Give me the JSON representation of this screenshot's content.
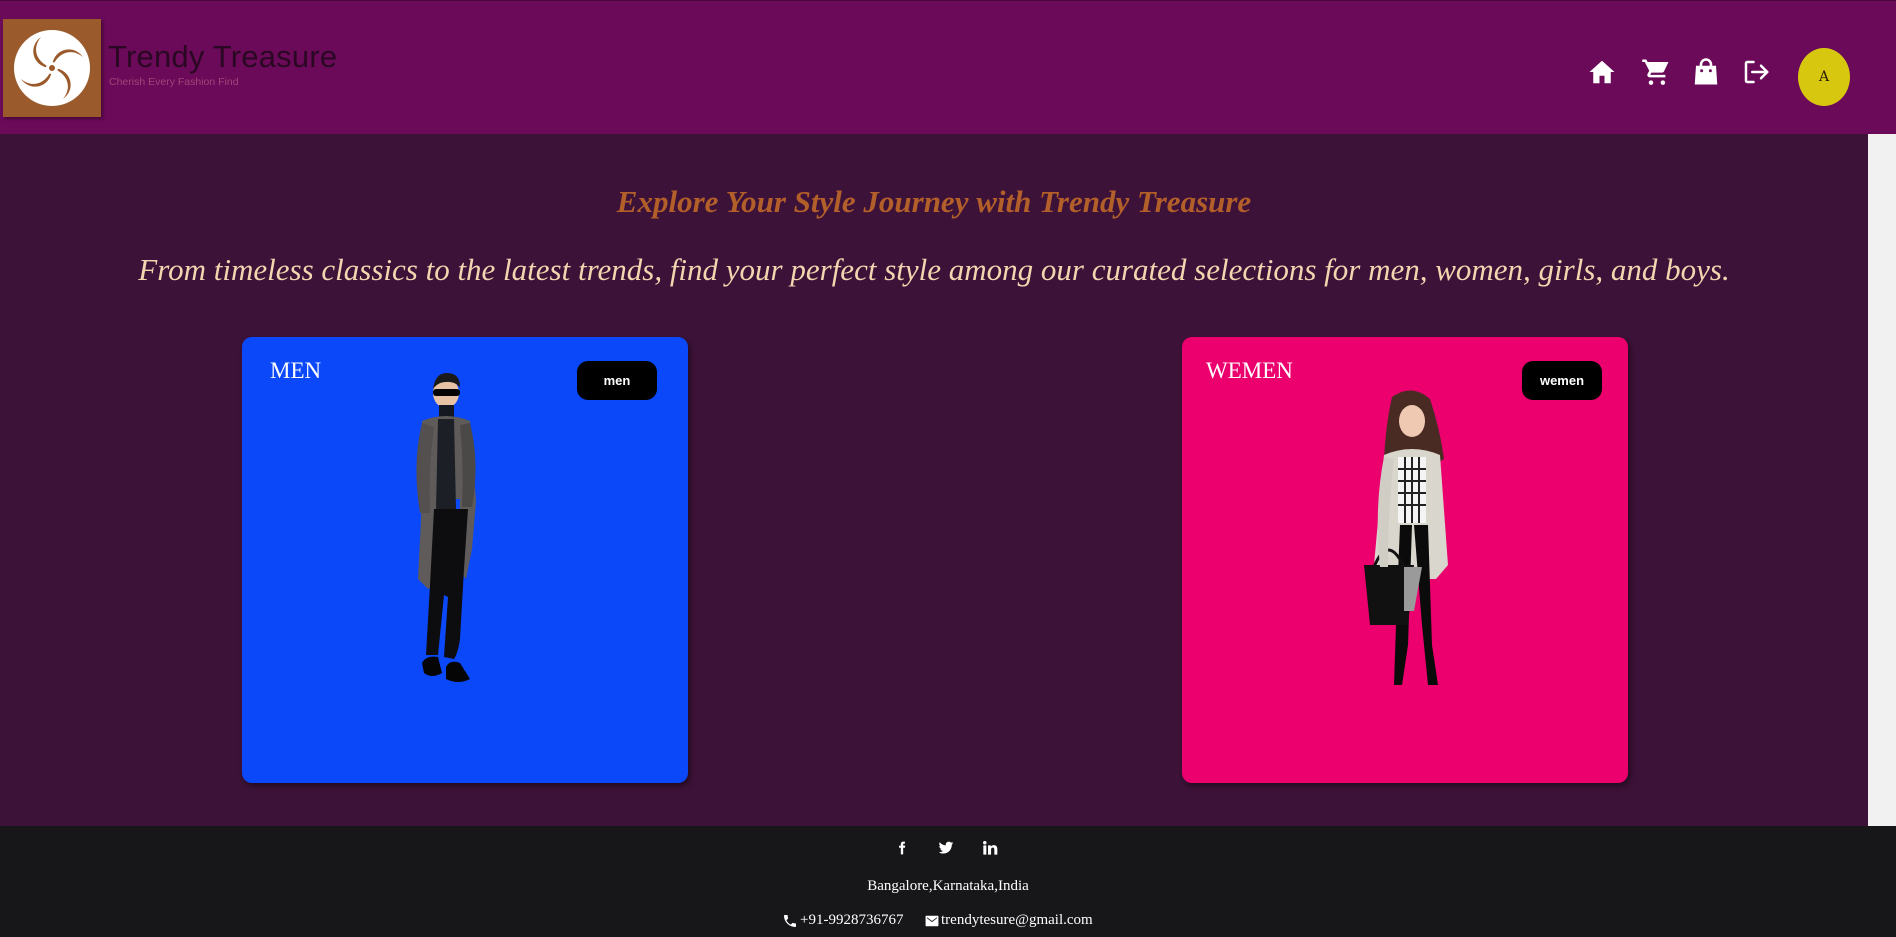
{
  "header": {
    "brand_name": "Trendy Treasure",
    "brand_tagline": "Cherish Every Fashion Find",
    "nav_icons": [
      "home-icon",
      "cart-icon",
      "shopping-bag-icon",
      "logout-icon"
    ],
    "avatar_initial": "A"
  },
  "main": {
    "heading": "Explore Your Style Journey with Trendy Treasure",
    "subheading": "From timeless classics to the latest trends, find your perfect style among our curated selections for men, women, girls, and boys.",
    "cards": [
      {
        "title": "MEN",
        "button_label": "men",
        "color": "#0b48f9"
      },
      {
        "title": "WEMEN",
        "button_label": "wemen",
        "color": "#ec006e"
      }
    ]
  },
  "footer": {
    "social_icons": [
      "facebook-icon",
      "twitter-icon",
      "linkedin-icon"
    ],
    "address": "Bangalore,Karnataka,India",
    "phone": "+91-9928736767",
    "email": "trendytesure@gmail.com"
  },
  "colors": {
    "header_bg": "#6a0a58",
    "main_bg": "#3d1238",
    "footer_bg": "#171619",
    "heading": "#b35f2a",
    "subheading": "#f2d6b0",
    "avatar": "#d7c80f"
  }
}
